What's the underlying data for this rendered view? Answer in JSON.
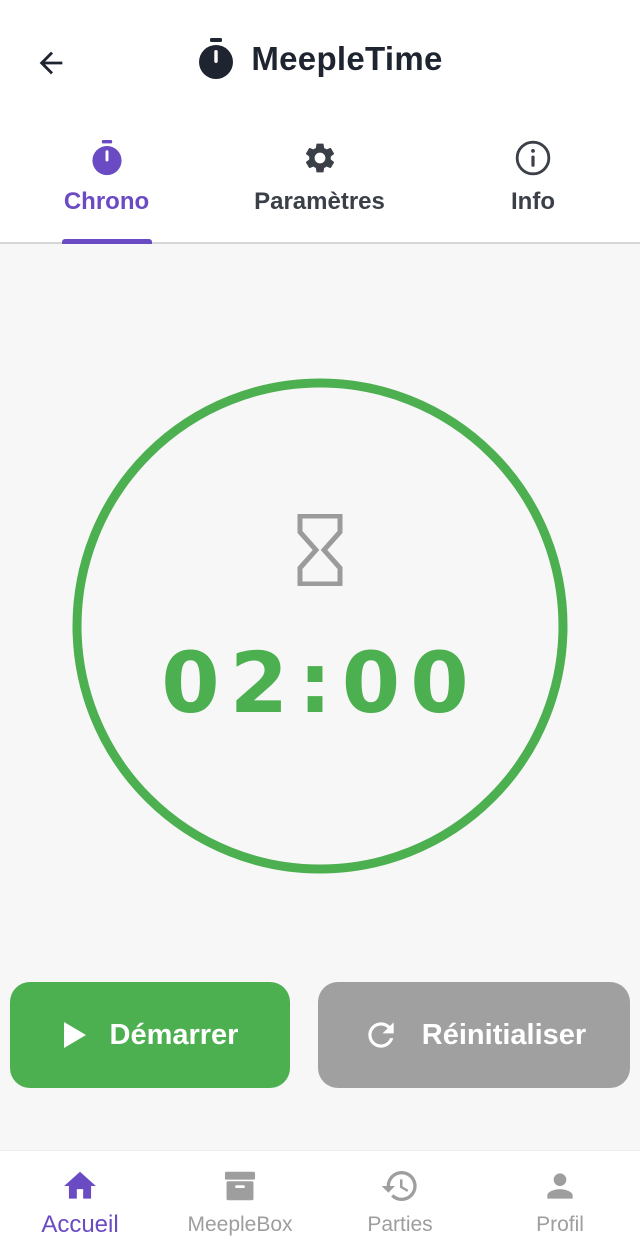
{
  "app": {
    "title": "MeepleTime",
    "title_icon": "stopwatch-icon",
    "back_icon": "arrow-left-icon"
  },
  "tabs": [
    {
      "label": "Chrono",
      "icon": "stopwatch-icon",
      "active": true
    },
    {
      "label": "Paramètres",
      "icon": "gear-icon",
      "active": false
    },
    {
      "label": "Info",
      "icon": "info-icon",
      "active": false
    }
  ],
  "timer": {
    "time": "02:00",
    "state_icon": "hourglass-icon",
    "ring_color": "#4caf50"
  },
  "buttons": {
    "start_label": "Démarrer",
    "start_icon": "play-icon",
    "reset_label": "Réinitialiser",
    "reset_icon": "refresh-icon"
  },
  "bottom_nav": [
    {
      "label": "Accueil",
      "icon": "home-icon",
      "active": true
    },
    {
      "label": "MeepleBox",
      "icon": "archive-box-icon",
      "active": false
    },
    {
      "label": "Parties",
      "icon": "history-icon",
      "active": false
    },
    {
      "label": "Profil",
      "icon": "person-icon",
      "active": false
    }
  ],
  "colors": {
    "accent": "#6a4bc3",
    "green": "#4caf50",
    "grey_button": "#a0a0a0",
    "background": "#f7f7f7"
  }
}
